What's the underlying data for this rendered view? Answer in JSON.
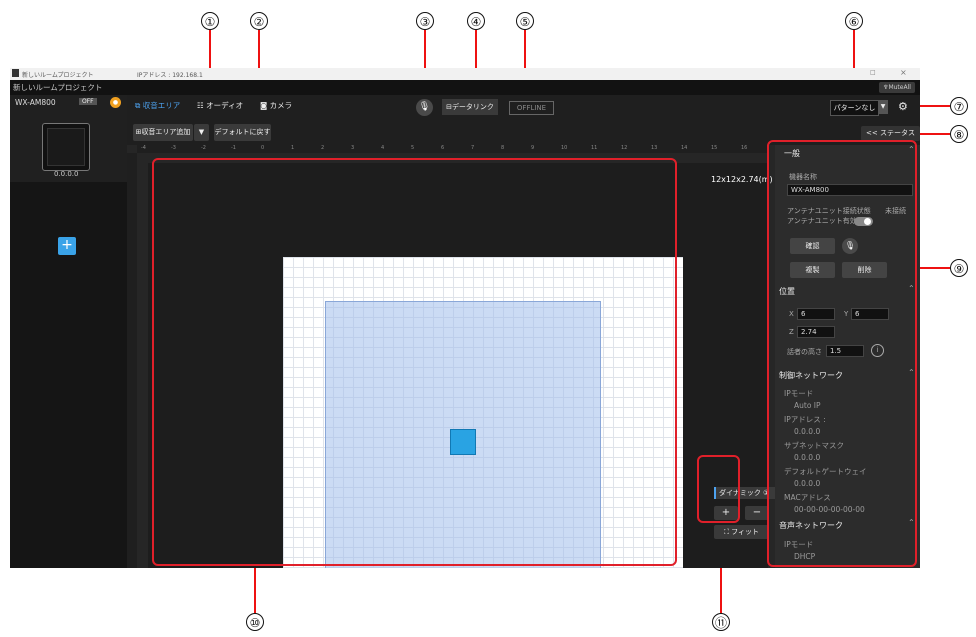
{
  "callouts": [
    "①",
    "②",
    "③",
    "④",
    "⑤",
    "⑥",
    "⑦",
    "⑧",
    "⑨",
    "⑩",
    "⑪"
  ],
  "window": {
    "title": "新しいルームプロジェクト",
    "ip_label": "IPアドレス : 192.168.1",
    "project_name": "新しいルームプロジェクト",
    "mute_all": "MuteAll"
  },
  "left_panel": {
    "device_name": "WX-AM800",
    "off_label": "OFF",
    "device_ip": "0.0.0.0",
    "add_symbol": "+"
  },
  "tabs": [
    "収音エリア",
    "オーディオ",
    "カメラ"
  ],
  "center": {
    "datalink_label": "データリンク",
    "offline_label": "OFFLINE"
  },
  "right_controls": {
    "pattern_label": "パターンなし"
  },
  "toolbar": {
    "add_area_label": "収音エリア追加",
    "reset_label": "デフォルトに戻す",
    "status_toggle": "<< ステータス"
  },
  "ruler_ticks": [
    "-4",
    "-3",
    "-2",
    "-1",
    "0",
    "1",
    "2",
    "3",
    "4",
    "5",
    "6",
    "7",
    "8",
    "9",
    "10",
    "11",
    "12",
    "13",
    "14",
    "15",
    "16"
  ],
  "canvas": {
    "room_size": "12x12x2.74(m)",
    "dynamic_label": "ダイナミック",
    "plus": "+",
    "minus": "−",
    "fit_label": "フィット"
  },
  "status": {
    "general_header": "一般",
    "device_name_label": "機器名称",
    "device_name_value": "WX-AM800",
    "antenna_status_label": "アンテナユニット接続状態",
    "antenna_status_value": "未接続",
    "antenna_enable_label": "アンテナユニット有効",
    "confirm_label": "確認",
    "copy_label": "複製",
    "delete_label": "削除",
    "position_header": "位置",
    "x_label": "X",
    "x_value": "6",
    "y_label": "Y",
    "y_value": "6",
    "z_label": "Z",
    "z_value": "2.74",
    "speaker_height_label": "話者の高さ",
    "speaker_height_value": "1.5",
    "control_net_header": "制御ネットワーク",
    "ip_mode_label": "IPモード",
    "ip_mode_value": "Auto IP",
    "ip_address_label": "IPアドレス :",
    "ip_address_value": "0.0.0.0",
    "subnet_label": "サブネットマスク",
    "subnet_value": "0.0.0.0",
    "gateway_label": "デフォルトゲートウェイ",
    "gateway_value": "0.0.0.0",
    "mac_label": "MACアドレス",
    "mac_value": "00-00-00-00-00-00",
    "audio_net_header": "音声ネットワーク",
    "audio_ip_mode_label": "IPモード",
    "audio_ip_mode_value": "DHCP"
  },
  "colors": {
    "highlight": "#e0202a",
    "device_blue": "#29a3e3",
    "area_blue": "#a0beeb",
    "accent_orange": "#f0a020"
  }
}
